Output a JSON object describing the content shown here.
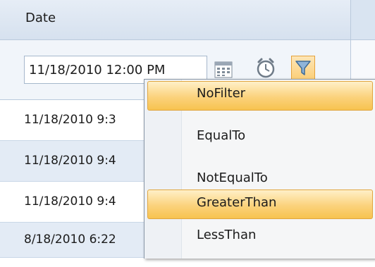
{
  "column": {
    "header": "Date"
  },
  "filter": {
    "input_value": "11/18/2010 12:00 PM",
    "icons": [
      "calendar-icon",
      "clock-icon",
      "funnel-icon"
    ]
  },
  "rows": [
    {
      "date": "11/18/2010 9:3"
    },
    {
      "date": "11/18/2010 9:4"
    },
    {
      "date": "11/18/2010 9:4"
    },
    {
      "date": "8/18/2010 6:22"
    }
  ],
  "menu": {
    "items": [
      {
        "label": "NoFilter",
        "highlighted": true
      },
      {
        "label": "EqualTo",
        "highlighted": false
      },
      {
        "label": "NotEqualTo",
        "highlighted": false
      },
      {
        "label": "GreaterThan",
        "highlighted": true
      },
      {
        "label": "LessThan",
        "highlighted": false
      }
    ]
  },
  "colors": {
    "header_bg": "#d6e1ef",
    "alt_row_bg": "#e3ebf5",
    "highlight": "#fbd27c",
    "highlight_border": "#e0a640"
  }
}
